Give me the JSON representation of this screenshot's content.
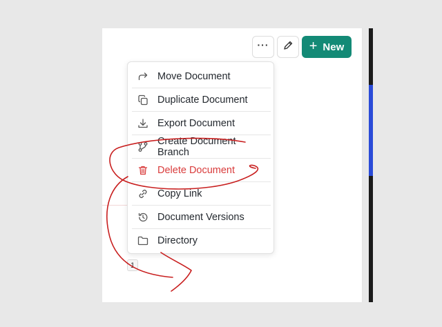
{
  "toolbar": {
    "more_label": "···",
    "new_label": "New",
    "new_plus": "+",
    "new_color": "#138a76"
  },
  "menu": {
    "items": [
      {
        "label": "Move Document",
        "icon": "move-arrow-icon"
      },
      {
        "label": "Duplicate Document",
        "icon": "duplicate-icon"
      },
      {
        "label": "Export Document",
        "icon": "download-icon"
      },
      {
        "label": "Create Document Branch",
        "icon": "branch-icon"
      },
      {
        "label": "Delete Document",
        "icon": "trash-icon",
        "danger": true
      },
      {
        "label": "Copy Link",
        "icon": "link-icon"
      },
      {
        "label": "Document Versions",
        "icon": "history-icon"
      },
      {
        "label": "Directory",
        "icon": "folder-icon"
      }
    ],
    "danger_color": "#d93b3b"
  },
  "pagination": {
    "page": "1"
  },
  "annotation": {
    "stroke_color": "#c81e1e"
  }
}
